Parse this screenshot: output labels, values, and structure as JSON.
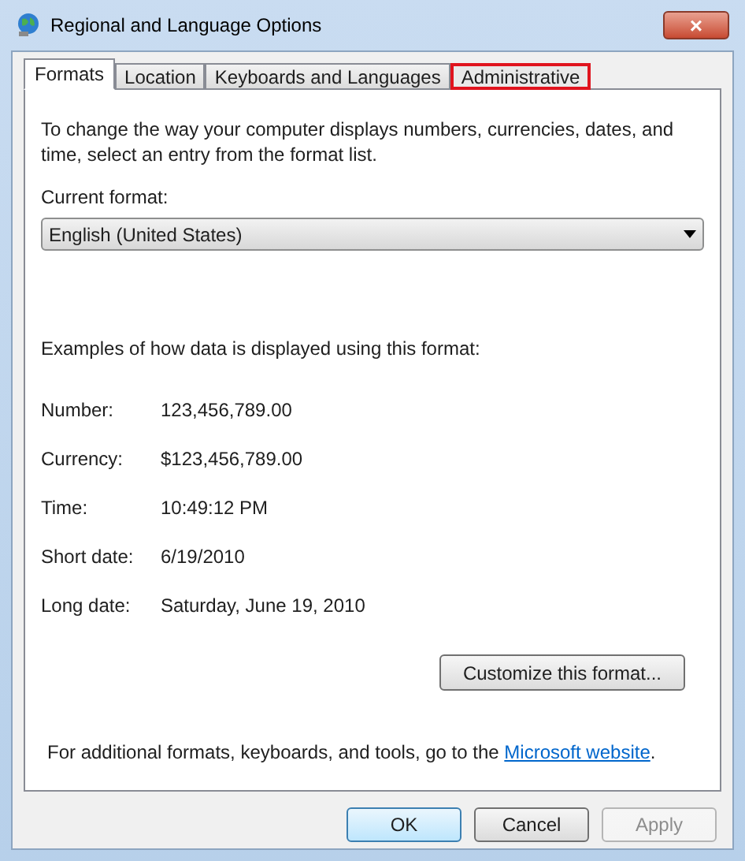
{
  "window": {
    "title": "Regional and Language Options",
    "close": "×"
  },
  "tabs": [
    {
      "label": "Formats",
      "selected": true,
      "highlighted": false
    },
    {
      "label": "Location",
      "selected": false,
      "highlighted": false
    },
    {
      "label": "Keyboards and Languages",
      "selected": false,
      "highlighted": false
    },
    {
      "label": "Administrative",
      "selected": false,
      "highlighted": true
    }
  ],
  "intro": "To change the way your computer displays numbers, currencies, dates, and time, select an entry from the format list.",
  "current_format": {
    "label": "Current format:",
    "value": "English (United States)"
  },
  "examples_heading": "Examples of how data is displayed using this format:",
  "examples": [
    {
      "label": "Number:",
      "value": "123,456,789.00"
    },
    {
      "label": "Currency:",
      "value": "$123,456,789.00"
    },
    {
      "label": "Time:",
      "value": "10:49:12 PM"
    },
    {
      "label": "Short date:",
      "value": "6/19/2010"
    },
    {
      "label": "Long date:",
      "value": "Saturday, June 19, 2010"
    }
  ],
  "customize_button": "Customize this format...",
  "footer": {
    "before": "For additional formats, keyboards, and tools, go to the ",
    "link": "Microsoft website",
    "after": "."
  },
  "buttons": [
    {
      "label": "OK",
      "kind": "default",
      "disabled": false
    },
    {
      "label": "Cancel",
      "kind": "normal",
      "disabled": false
    },
    {
      "label": "Apply",
      "kind": "normal",
      "disabled": true
    }
  ]
}
